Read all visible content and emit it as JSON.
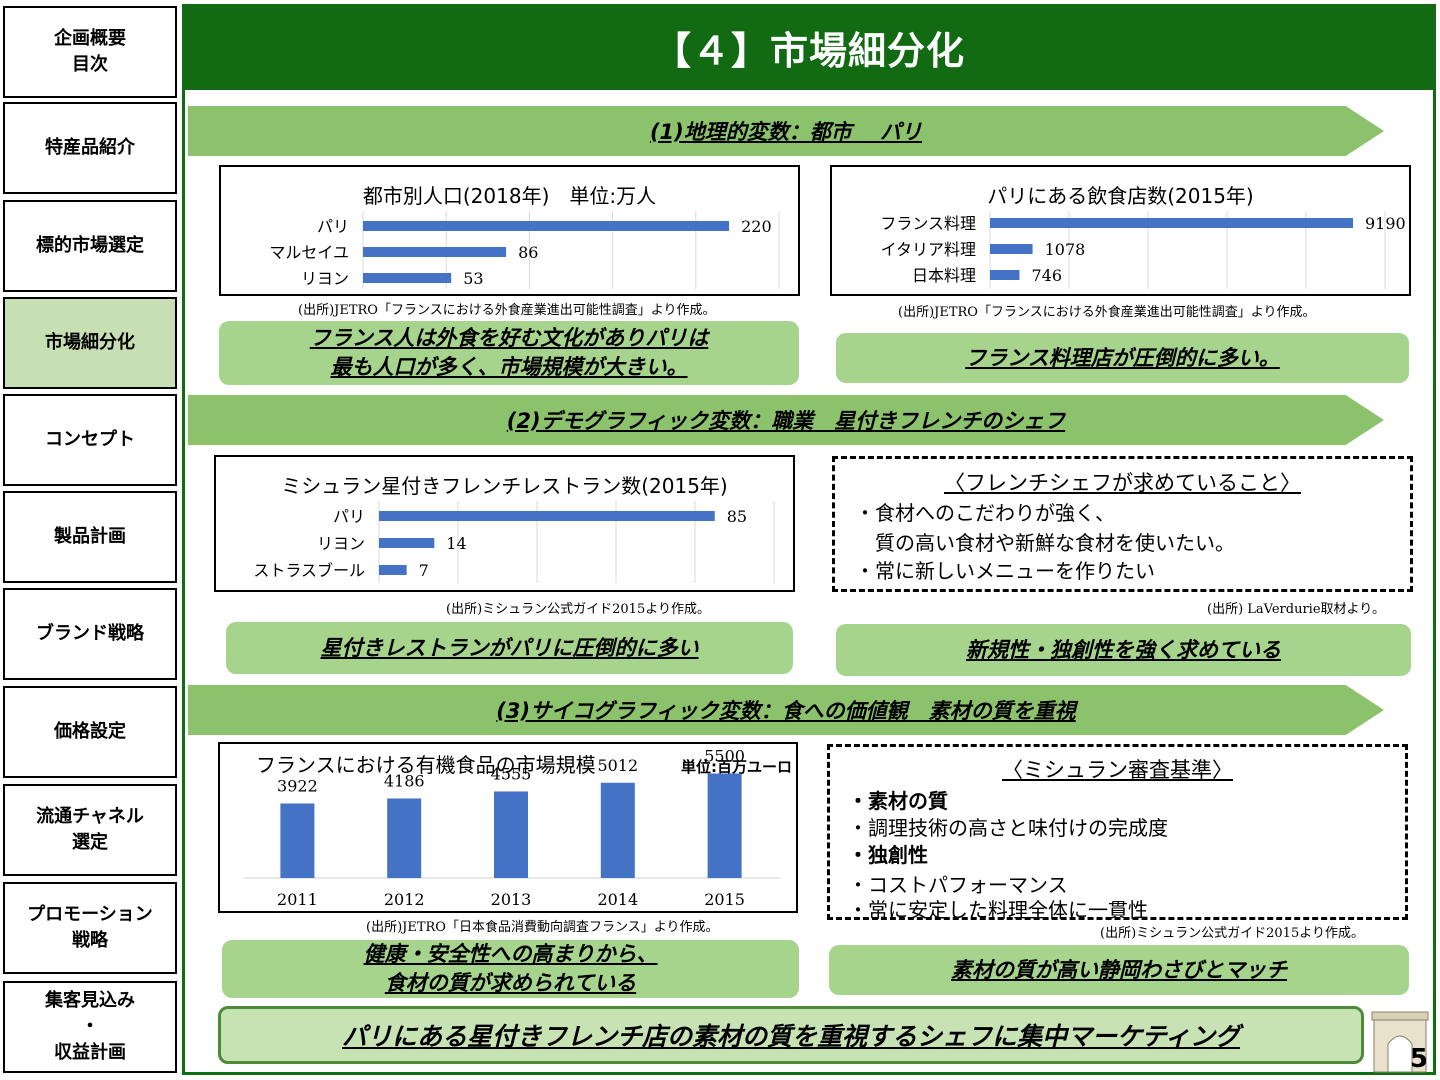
{
  "title": "【４】市場細分化",
  "sidebar": {
    "items": [
      {
        "label": "企画概要\n目次",
        "active": false
      },
      {
        "label": "特産品紹介",
        "active": false
      },
      {
        "label": "標的市場選定",
        "active": false
      },
      {
        "label": "市場細分化",
        "active": true
      },
      {
        "label": "コンセプト",
        "active": false
      },
      {
        "label": "製品計画",
        "active": false
      },
      {
        "label": "ブランド戦略",
        "active": false
      },
      {
        "label": "価格設定",
        "active": false
      },
      {
        "label": "流通チャネル\n選定",
        "active": false
      },
      {
        "label": "プロモーション\n戦略",
        "active": false
      },
      {
        "label": "集客見込み\n・\n収益計画",
        "active": false
      }
    ]
  },
  "sections": [
    {
      "label": "(1)地理的変数：都市　 パリ"
    },
    {
      "label": "(2)デモグラフィック変数：職業　星付きフレンチのシェフ"
    },
    {
      "label": "(3)サイコグラフィック変数：食への価値観　素材の質を重視"
    }
  ],
  "sources": {
    "s1": "(出所)JETRO「フランスにおける外食産業進出可能性調査」より作成。",
    "s2": "(出所)JETRO「フランスにおける外食産業進出可能性調査」より作成。",
    "s3": "(出所)ミシュラン公式ガイド2015より作成。",
    "s4": "(出所) LaVerdurie取材より。",
    "s5": "(出所)JETRO「日本食品消費動向調査フランス」より作成。",
    "s6": "(出所)ミシュラン公式ガイド2015より作成。"
  },
  "callouts": {
    "c1": "フランス人は外食を好む文化がありパリは\n最も人口が多く、市場規模が大きい。",
    "c2": "フランス料理店が圧倒的に多い。",
    "c3": "星付きレストランがパリに圧倒的に多い",
    "c4": "新規性・独創性を強く求めている",
    "c5": "健康・安全性への高まりから、\n食材の質が求められている",
    "c6": "素材の質が高い静岡わさびとマッチ"
  },
  "chef_box": {
    "title": "〈フレンチシェフが求めていること〉",
    "lines": [
      "・食材へのこだわりが強く、",
      "　質の高い食材や新鮮な食材を使いたい。",
      "・常に新しいメニューを作りたい"
    ]
  },
  "michelin_box": {
    "title": "〈ミシュラン審査基準〉",
    "lines": [
      "・素材の質",
      "・調理技術の高さと味付けの完成度",
      "・独創性",
      "・コストパフォーマンス",
      "・常に安定した料理全体に一貫性"
    ]
  },
  "conclusion": "パリにある星付きフレンチ店の素材の質を重視するシェフに集中マーケティング",
  "page_number": "5",
  "colors": {
    "bar": "#4472c4",
    "title_bar": "#126a13",
    "arrow": "#8dc26d",
    "callout": "#a6d48c"
  },
  "chart_data": [
    {
      "type": "bar",
      "orientation": "horizontal",
      "title": "都市別人口(2018年)　単位:万人",
      "categories": [
        "パリ",
        "マルセイユ",
        "リヨン"
      ],
      "values": [
        220,
        86,
        53
      ],
      "xlim": [
        0,
        250
      ],
      "grid": true
    },
    {
      "type": "bar",
      "orientation": "horizontal",
      "title": "パリにある飲食店数(2015年)",
      "categories": [
        "フランス料理",
        "イタリア料理",
        "日本料理"
      ],
      "values": [
        9190,
        1078,
        746
      ],
      "xlim": [
        0,
        10000
      ],
      "grid": true
    },
    {
      "type": "bar",
      "orientation": "horizontal",
      "title": "ミシュラン星付きフレンチレストラン数(2015年)",
      "categories": [
        "パリ",
        "リヨン",
        "ストラスブール"
      ],
      "values": [
        85,
        14,
        7
      ],
      "xlim": [
        0,
        100
      ],
      "grid": true
    },
    {
      "type": "bar",
      "orientation": "vertical",
      "title": "フランスにおける有機食品の市場規模",
      "unit_label": "単位:百万ユーロ",
      "categories": [
        "2011",
        "2012",
        "2013",
        "2014",
        "2015"
      ],
      "values": [
        3922,
        4186,
        4555,
        5012,
        5500
      ],
      "ylim": [
        0,
        6000
      ],
      "grid": false
    }
  ]
}
